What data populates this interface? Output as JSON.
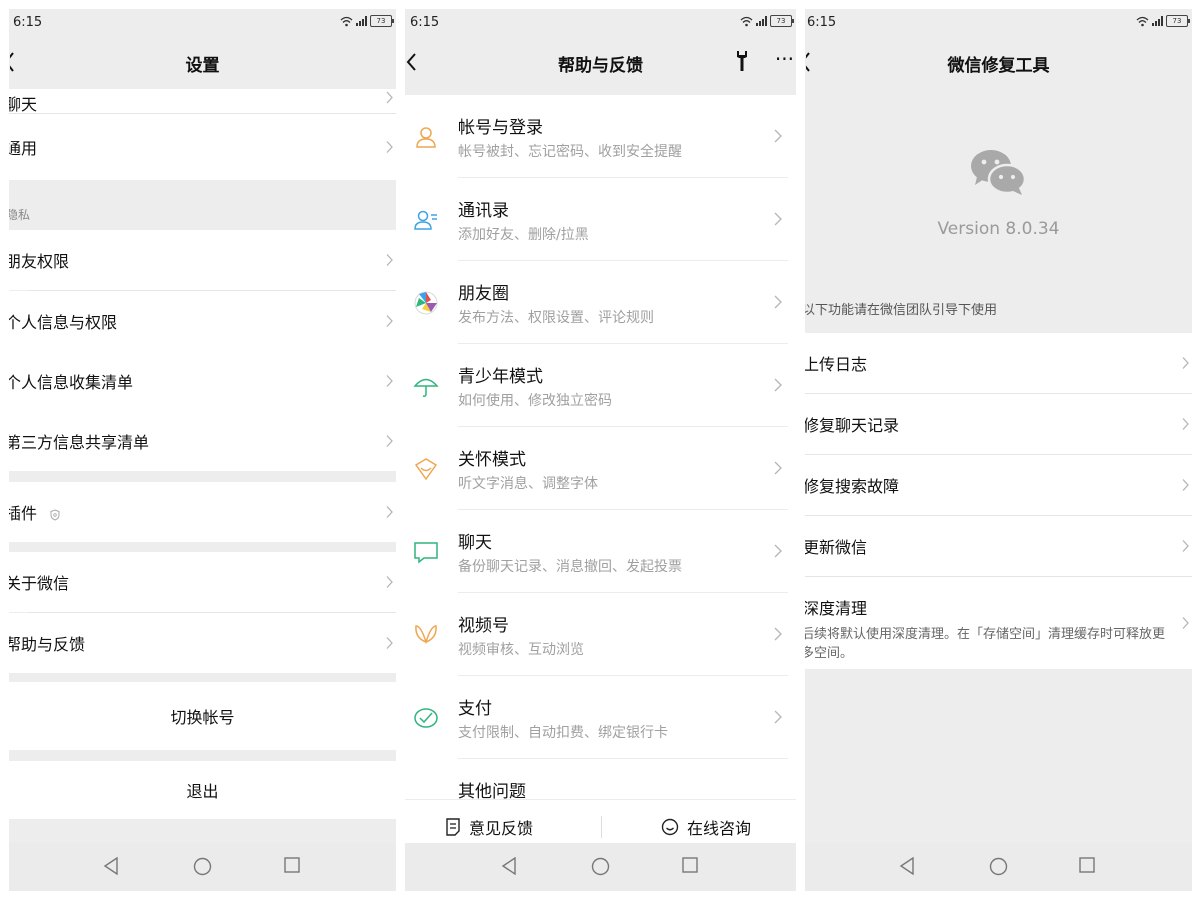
{
  "status_bar": {
    "time": "6:15",
    "battery": "73"
  },
  "settings_panel": {
    "title": "设置",
    "partial_top_row": "聊天",
    "general": "通用",
    "privacy_section": "隐私",
    "friends_permission": "朋友权限",
    "personal_info_permission": "个人信息与权限",
    "personal_info_collection": "个人信息收集清单",
    "third_party_sharing": "第三方信息共享清单",
    "plugins": "插件",
    "about_wechat": "关于微信",
    "help_feedback": "帮助与反馈",
    "switch_account": "切换帐号",
    "logout": "退出"
  },
  "help_panel": {
    "title": "帮助与反馈",
    "items": [
      {
        "title": "帐号与登录",
        "subtitle": "帐号被封、忘记密码、收到安全提醒",
        "icon": "person-icon",
        "color": "#f0a650"
      },
      {
        "title": "通讯录",
        "subtitle": "添加好友、删除/拉黑",
        "icon": "contacts-icon",
        "color": "#3aa4e6"
      },
      {
        "title": "朋友圈",
        "subtitle": "发布方法、权限设置、评论规则",
        "icon": "aperture-icon",
        "color": "#e0504d"
      },
      {
        "title": "青少年模式",
        "subtitle": "如何使用、修改独立密码",
        "icon": "umbrella-icon",
        "color": "#2fb67c"
      },
      {
        "title": "关怀模式",
        "subtitle": "听文字消息、调整字体",
        "icon": "care-icon",
        "color": "#f0a650"
      },
      {
        "title": "聊天",
        "subtitle": "备份聊天记录、消息撤回、发起投票",
        "icon": "chat-bubble-icon",
        "color": "#2fb67c"
      },
      {
        "title": "视频号",
        "subtitle": "视频审核、互动浏览",
        "icon": "butterfly-icon",
        "color": "#f0a650"
      },
      {
        "title": "支付",
        "subtitle": "支付限制、自动扣费、绑定银行卡",
        "icon": "pay-check-icon",
        "color": "#2fb67c"
      },
      {
        "title": "其他问题",
        "subtitle": "",
        "icon": "",
        "color": "#999999"
      }
    ],
    "footer": {
      "feedback": "意见反馈",
      "online_consult": "在线咨询"
    }
  },
  "repair_panel": {
    "title": "微信修复工具",
    "version": "Version 8.0.34",
    "note": "以下功能请在微信团队引导下使用",
    "upload_log": "上传日志",
    "repair_chat": "修复聊天记录",
    "repair_search": "修复搜索故障",
    "update_wechat": "更新微信",
    "deep_clean_title": "深度清理",
    "deep_clean_desc": "后续将默认使用深度清理。在「存储空间」清理缓存时可释放更多空间。"
  }
}
